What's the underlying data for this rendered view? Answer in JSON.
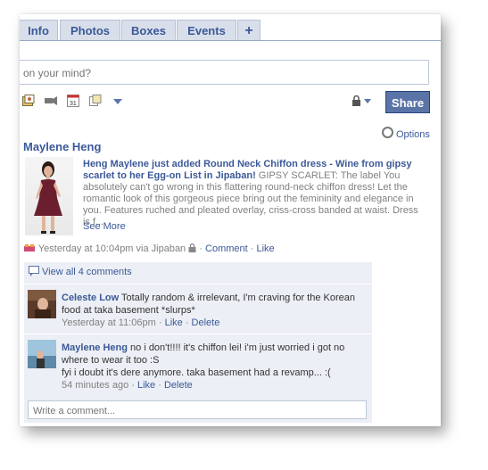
{
  "tabs": [
    {
      "label": "Info"
    },
    {
      "label": "Photos"
    },
    {
      "label": "Boxes"
    },
    {
      "label": "Events"
    },
    {
      "label": "+"
    }
  ],
  "composer": {
    "placeholder": "on your mind?"
  },
  "share_label": "Share",
  "options_label": "Options",
  "post": {
    "author": "Maylene Heng",
    "headline": "Heng Maylene just added Round Neck Chiffon dress - Wine from gipsy scarlet to her Egg-on List in Jipaban!",
    "body": " GIPSY SCARLET: The label You absolutely can't go wrong in this flattering round-neck chiffon dress! Let the romantic look of this gorgeous piece bring out the femininity and elegance in you. Features ruched and pleated overlay, criss-cross banded at waist. Dress is f...",
    "see_more": "See More",
    "meta": {
      "time": "Yesterday at 10:04pm via Jipaban",
      "comment": "Comment",
      "like": "Like"
    }
  },
  "comments": {
    "view_all": "View all 4 comments",
    "items": [
      {
        "name": "Celeste Low",
        "text": " Totally random & irrelevant, I'm craving for the Korean food at taka basement *slurps*",
        "time": "Yesterday at 11:06pm",
        "like": "Like",
        "delete": "Delete"
      },
      {
        "name": "Maylene Heng",
        "text": " no i don't!!!! it's chiffon lei! i'm just worried i got no where to wear it too :S",
        "text2": "fyi i doubt it's dere anymore. taka basement had a revamp... :(",
        "time": "54 minutes ago",
        "like": "Like",
        "delete": "Delete"
      }
    ],
    "write_placeholder": "Write a comment..."
  }
}
